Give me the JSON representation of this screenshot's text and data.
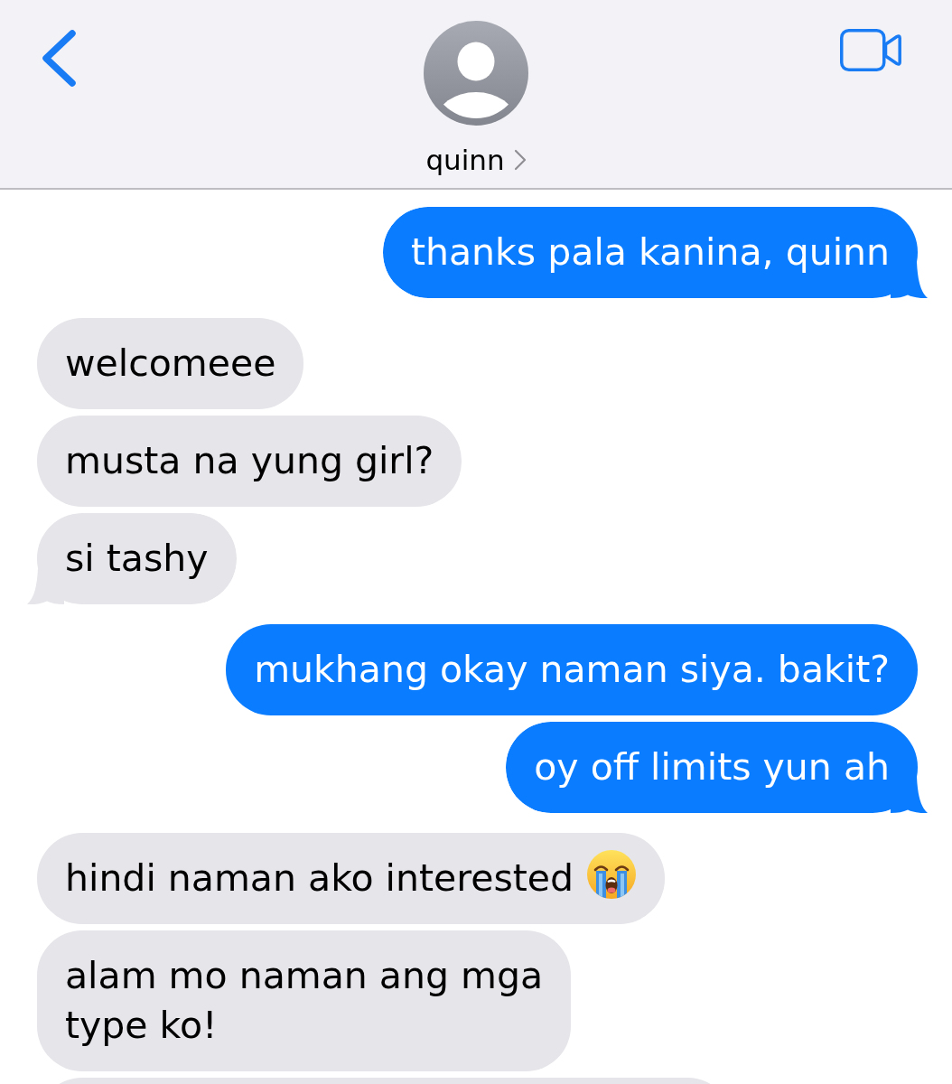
{
  "header": {
    "contact": {
      "name": "quinn"
    }
  },
  "messages": [
    {
      "outgoing": true,
      "kind": "text",
      "text": "thanks pala kanina, quinn"
    },
    {
      "outgoing": false,
      "kind": "text",
      "text": "welcomeee"
    },
    {
      "outgoing": false,
      "kind": "text",
      "text": "musta na yung girl?"
    },
    {
      "outgoing": false,
      "kind": "text",
      "text": "si tashy"
    },
    {
      "outgoing": true,
      "kind": "text",
      "text": "mukhang okay naman siya. bakit?"
    },
    {
      "outgoing": true,
      "kind": "text",
      "text": "oy off limits yun ah"
    },
    {
      "outgoing": false,
      "kind": "text-emoji",
      "text": "hindi naman ako interested"
    },
    {
      "outgoing": false,
      "kind": "text",
      "text": "alam mo naman ang mga\ntype ko!"
    },
    {
      "outgoing": false,
      "kind": "cut-off"
    }
  ]
}
